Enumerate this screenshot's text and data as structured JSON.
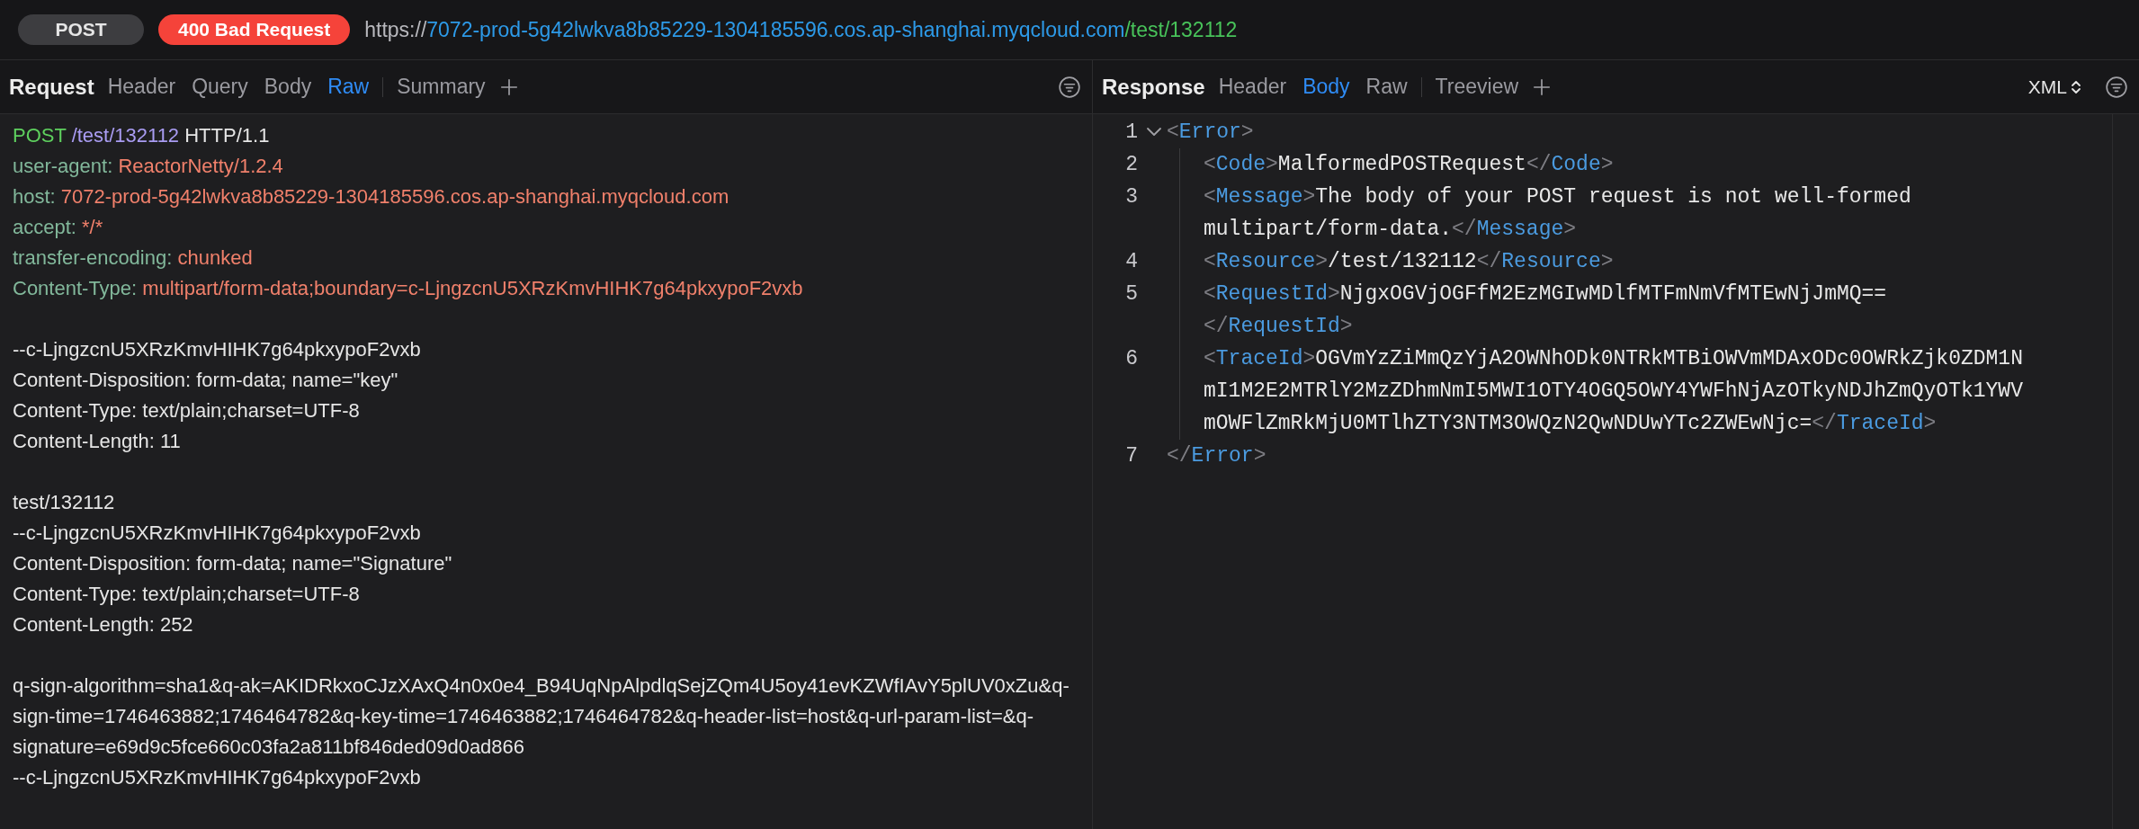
{
  "top_bar": {
    "method": "POST",
    "status": "400 Bad Request",
    "url": {
      "scheme": "https://",
      "host": "7072-prod-5g42lwkva8b85229-1304185596.cos.ap-shanghai.myqcloud.com",
      "path": "/test/132112"
    }
  },
  "request": {
    "title": "Request",
    "tabs": [
      {
        "label": "Header",
        "selected": false
      },
      {
        "label": "Query",
        "selected": false
      },
      {
        "label": "Body",
        "selected": false
      },
      {
        "label": "Raw",
        "selected": true
      }
    ],
    "extra_tabs": [
      {
        "label": "Summary",
        "selected": false
      }
    ],
    "lines": [
      {
        "kind": "request",
        "method": "POST",
        "path": "/test/132112",
        "version": "HTTP/1.1"
      },
      {
        "kind": "header",
        "name": "user-agent:",
        "value": "ReactorNetty/1.2.4"
      },
      {
        "kind": "header",
        "name": "host:",
        "value": "7072-prod-5g42lwkva8b85229-1304185596.cos.ap-shanghai.myqcloud.com"
      },
      {
        "kind": "header",
        "name": "accept:",
        "value": "*/*"
      },
      {
        "kind": "header",
        "name": "transfer-encoding:",
        "value": "chunked"
      },
      {
        "kind": "header",
        "name": "Content-Type:",
        "value": "multipart/form-data;boundary=c-LjngzcnU5XRzKmvHIHK7g64pkxypoF2vxb"
      },
      {
        "kind": "blank"
      },
      {
        "kind": "text",
        "text": "--c-LjngzcnU5XRzKmvHIHK7g64pkxypoF2vxb"
      },
      {
        "kind": "text",
        "text": "Content-Disposition: form-data; name=\"key\""
      },
      {
        "kind": "text",
        "text": "Content-Type: text/plain;charset=UTF-8"
      },
      {
        "kind": "text",
        "text": "Content-Length: 11"
      },
      {
        "kind": "blank"
      },
      {
        "kind": "text",
        "text": "test/132112"
      },
      {
        "kind": "text",
        "text": "--c-LjngzcnU5XRzKmvHIHK7g64pkxypoF2vxb"
      },
      {
        "kind": "text",
        "text": "Content-Disposition: form-data; name=\"Signature\""
      },
      {
        "kind": "text",
        "text": "Content-Type: text/plain;charset=UTF-8"
      },
      {
        "kind": "text",
        "text": "Content-Length: 252"
      },
      {
        "kind": "blank"
      },
      {
        "kind": "text",
        "text": "q-sign-algorithm=sha1&q-ak=AKIDRkxoCJzXAxQ4n0x0e4_B94UqNpAlpdlqSejZQm4U5oy41evKZWfIAvY5plUV0xZu&q-sign-time=1746463882;1746464782&q-key-time=1746463882;1746464782&q-header-list=host&q-url-param-list=&q-signature=e69d9c5fce660c03fa2a811bf846ded09d0ad866"
      },
      {
        "kind": "text",
        "text": "--c-LjngzcnU5XRzKmvHIHK7g64pkxypoF2vxb"
      }
    ]
  },
  "response": {
    "title": "Response",
    "tabs": [
      {
        "label": "Header",
        "selected": false
      },
      {
        "label": "Body",
        "selected": true
      },
      {
        "label": "Raw",
        "selected": false
      }
    ],
    "extra_tabs": [
      {
        "label": "Treeview",
        "selected": false
      }
    ],
    "format": "XML",
    "root": {
      "number": "1",
      "expanded": true,
      "open": [
        {
          "kind": "punct",
          "text": "<"
        },
        {
          "kind": "tag",
          "text": "Error"
        },
        {
          "kind": "punct",
          "text": ">"
        }
      ],
      "children": [
        {
          "number": "2",
          "tokens": [
            {
              "kind": "punct",
              "text": "<"
            },
            {
              "kind": "tag",
              "text": "Code"
            },
            {
              "kind": "punct",
              "text": ">"
            },
            {
              "kind": "text",
              "text": "MalformedPOSTRequest"
            },
            {
              "kind": "punct",
              "text": "</"
            },
            {
              "kind": "tag",
              "text": "Code"
            },
            {
              "kind": "punct",
              "text": ">"
            }
          ]
        },
        {
          "number": "3",
          "tokens": [
            {
              "kind": "punct",
              "text": "<"
            },
            {
              "kind": "tag",
              "text": "Message"
            },
            {
              "kind": "punct",
              "text": ">"
            },
            {
              "kind": "text",
              "text": "The body of your POST request is not well-formed multipart/form-data."
            },
            {
              "kind": "punct",
              "text": "</"
            },
            {
              "kind": "tag",
              "text": "Message"
            },
            {
              "kind": "punct",
              "text": ">"
            }
          ]
        },
        {
          "number": "4",
          "tokens": [
            {
              "kind": "punct",
              "text": "<"
            },
            {
              "kind": "tag",
              "text": "Resource"
            },
            {
              "kind": "punct",
              "text": ">"
            },
            {
              "kind": "text",
              "text": "/test/132112"
            },
            {
              "kind": "punct",
              "text": "</"
            },
            {
              "kind": "tag",
              "text": "Resource"
            },
            {
              "kind": "punct",
              "text": ">"
            }
          ]
        },
        {
          "number": "5",
          "tokens": [
            {
              "kind": "punct",
              "text": "<"
            },
            {
              "kind": "tag",
              "text": "RequestId"
            },
            {
              "kind": "punct",
              "text": ">"
            },
            {
              "kind": "text",
              "text": "NjgxOGVjOGFfM2EzMGIwMDlfMTFmNmVfMTEwNjJmMQ=="
            },
            {
              "kind": "punct",
              "text": "</"
            },
            {
              "kind": "tag",
              "text": "RequestId"
            },
            {
              "kind": "punct",
              "text": ">"
            }
          ]
        },
        {
          "number": "6",
          "tokens": [
            {
              "kind": "punct",
              "text": "<"
            },
            {
              "kind": "tag",
              "text": "TraceId"
            },
            {
              "kind": "punct",
              "text": ">"
            },
            {
              "kind": "text",
              "text": "OGVmYzZiMmQzYjA2OWNhODk0NTRkMTBiOWVmMDAxODc0OWRkZjk0ZDM1NmI1M2E2MTRlY2MzZDhmNmI5MWI1OTY4OGQ5OWY4YWFhNjAzOTkyNDJhZmQyOTk1YWVmOWFlZmRkMjU0MTlhZTY3NTM3OWQzN2QwNDUwYTc2ZWEwNjc="
            },
            {
              "kind": "punct",
              "text": "</"
            },
            {
              "kind": "tag",
              "text": "TraceId"
            },
            {
              "kind": "punct",
              "text": ">"
            }
          ]
        }
      ],
      "close": {
        "number": "7",
        "tokens": [
          {
            "kind": "punct",
            "text": "</"
          },
          {
            "kind": "tag",
            "text": "Error"
          },
          {
            "kind": "punct",
            "text": ">"
          }
        ]
      }
    }
  }
}
